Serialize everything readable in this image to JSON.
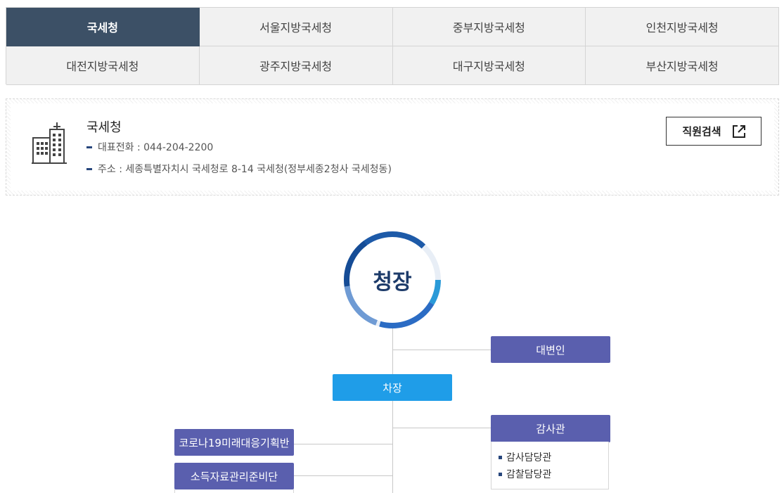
{
  "tabs": [
    {
      "label": "국세청",
      "active": true
    },
    {
      "label": "서울지방국세청"
    },
    {
      "label": "중부지방국세청"
    },
    {
      "label": "인천지방국세청"
    },
    {
      "label": "대전지방국세청"
    },
    {
      "label": "광주지방국세청"
    },
    {
      "label": "대구지방국세청"
    },
    {
      "label": "부산지방국세청"
    }
  ],
  "info": {
    "name": "국세청",
    "phone": "대표전화 : 044-204-2200",
    "address": "주소 : 세종특별자치시 국세청로 8-14 국세청(정부세종2청사 국세청동)",
    "staff_search": "직원검색",
    "icon": "building-icon",
    "external_icon": "external-link-icon"
  },
  "org": {
    "chief": "청장",
    "spokesperson": "대변인",
    "deputy": "차장",
    "auditor": "감사관",
    "auditor_subs": [
      "감사담당관",
      "감찰담당관"
    ],
    "left_units": [
      "코로나19미래대응기획반",
      "소득자료관리준비단"
    ]
  },
  "colors": {
    "active_tab": "#3c5066",
    "unit_box": "#5a5fae",
    "deputy_box": "#1f9de8",
    "chief_ring": "#1a4f9c",
    "accent": "#27467c"
  }
}
